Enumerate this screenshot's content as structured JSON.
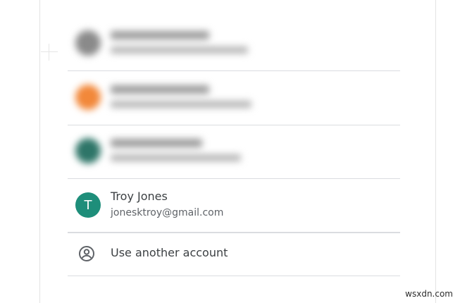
{
  "accounts": [
    {
      "blurred": true,
      "avatar_color": "#8a8a8a"
    },
    {
      "blurred": true,
      "avatar_color": "#f2883a"
    },
    {
      "blurred": true,
      "avatar_color": "#2e7568"
    },
    {
      "blurred": false,
      "avatar_color": "#1e8e7a",
      "avatar_letter": "T",
      "name": "Troy Jones",
      "email": "jonesktroy@gmail.com"
    }
  ],
  "use_another": {
    "label": "Use another account",
    "icon": "account-circle-icon"
  },
  "watermark": "wsxdn.com",
  "colors": {
    "divider": "#dadce0",
    "text_primary": "#3c4043",
    "text_secondary": "#5f6368"
  }
}
